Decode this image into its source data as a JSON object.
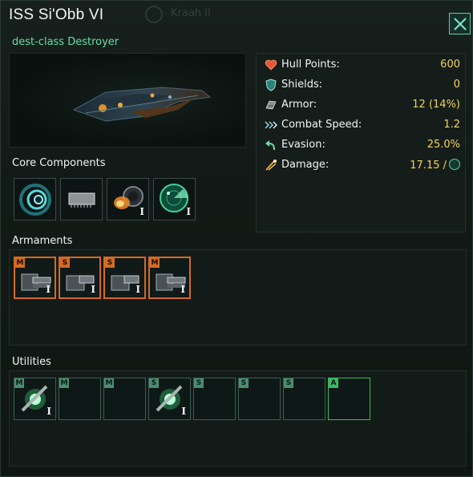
{
  "window": {
    "title": "ISS Si'Obb VI",
    "ship_class": "dest-class Destroyer",
    "background_tab_text": "Kraah II",
    "close_icon": "close-icon"
  },
  "stats": [
    {
      "icon": "heart-icon",
      "label": "Hull Points:",
      "value": "600"
    },
    {
      "icon": "shield-icon",
      "label": "Shields:",
      "value": "0"
    },
    {
      "icon": "armor-icon",
      "label": "Armor:",
      "value": "12 (14%)"
    },
    {
      "icon": "speed-icon",
      "label": "Combat Speed:",
      "value": "1.2"
    },
    {
      "icon": "evasion-icon",
      "label": "Evasion:",
      "value": "25.0%"
    },
    {
      "icon": "damage-icon",
      "label": "Damage:",
      "value": "17.15 /"
    }
  ],
  "sections": {
    "core": "Core Components",
    "armaments": "Armaments",
    "utilities": "Utilities"
  },
  "core_components": [
    {
      "icon": "ftl-drive-icon",
      "tier": ""
    },
    {
      "icon": "computer-chip-icon",
      "tier": ""
    },
    {
      "icon": "thruster-icon",
      "tier": "I"
    },
    {
      "icon": "sensor-radar-icon",
      "tier": "I"
    }
  ],
  "armaments": [
    {
      "size": "M",
      "icon": "turret-icon",
      "tier": "I"
    },
    {
      "size": "S",
      "icon": "turret-icon",
      "tier": "I"
    },
    {
      "size": "S",
      "icon": "turret-icon",
      "tier": "I"
    },
    {
      "size": "M",
      "icon": "turret-icon",
      "tier": "I"
    }
  ],
  "utilities": [
    {
      "size": "M",
      "icon": "shield-emitter-icon",
      "tier": "I"
    },
    {
      "size": "M",
      "icon": "",
      "tier": ""
    },
    {
      "size": "M",
      "icon": "",
      "tier": ""
    },
    {
      "size": "S",
      "icon": "shield-emitter-icon",
      "tier": "I"
    },
    {
      "size": "S",
      "icon": "",
      "tier": ""
    },
    {
      "size": "S",
      "icon": "",
      "tier": ""
    },
    {
      "size": "S",
      "icon": "",
      "tier": ""
    },
    {
      "size": "A",
      "icon": "",
      "tier": ""
    }
  ],
  "colors": {
    "accent_green": "#5fe0a6",
    "value_yellow": "#f5d25a",
    "weapon_orange": "#d66a22",
    "utility_green": "#4a8c72",
    "aux_green": "#3bb663"
  }
}
